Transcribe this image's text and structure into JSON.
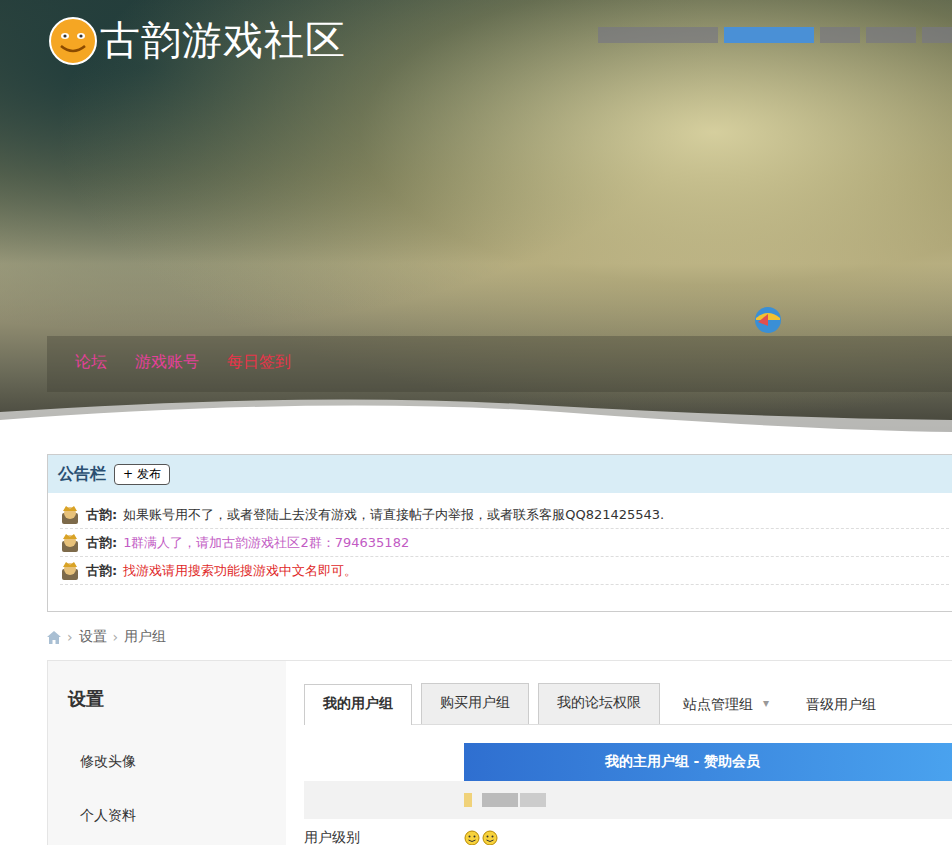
{
  "logo": {
    "text": "古韵游戏社区"
  },
  "nav": [
    {
      "label": "论坛",
      "selected": false,
      "color": "#e6409b"
    },
    {
      "label": "游戏账号",
      "selected": false,
      "color": "#e6409b"
    },
    {
      "label": "每日签到",
      "selected": false,
      "color": "#e8344a"
    }
  ],
  "notice": {
    "title": "公告栏",
    "publish_button": "+ 发布",
    "items": [
      {
        "author": "古韵:",
        "text": "如果账号用不了，或者登陆上去没有游戏，请直接帖子内举报，或者联系客服QQ821425543.",
        "color": "#333333"
      },
      {
        "author": "古韵:",
        "text": "1群满人了，请加古韵游戏社区2群：794635182",
        "color": "#c25bc4"
      },
      {
        "author": "古韵:",
        "text": "找游戏请用搜索功能搜游戏中文名即可。",
        "color": "#e02828"
      }
    ]
  },
  "breadcrumb": [
    "设置",
    "用户组"
  ],
  "sidebar": {
    "title": "设置",
    "items": [
      "修改头像",
      "个人资料"
    ]
  },
  "tabs": [
    {
      "label": "我的用户组",
      "selected": true
    },
    {
      "label": "购买用户组",
      "selected": false
    },
    {
      "label": "我的论坛权限",
      "selected": false
    }
  ],
  "menus": [
    {
      "label": "站点管理组",
      "arrow": "▾"
    },
    {
      "label": "晋级用户组",
      "arrow": ""
    }
  ],
  "group_table": {
    "header": "我的主用户组 - 赞助会员",
    "rows": [
      {
        "label": "",
        "level_icons": 0,
        "blurred": true
      },
      {
        "label": "用户级别",
        "level_icons": 2,
        "blurred": false
      }
    ]
  }
}
